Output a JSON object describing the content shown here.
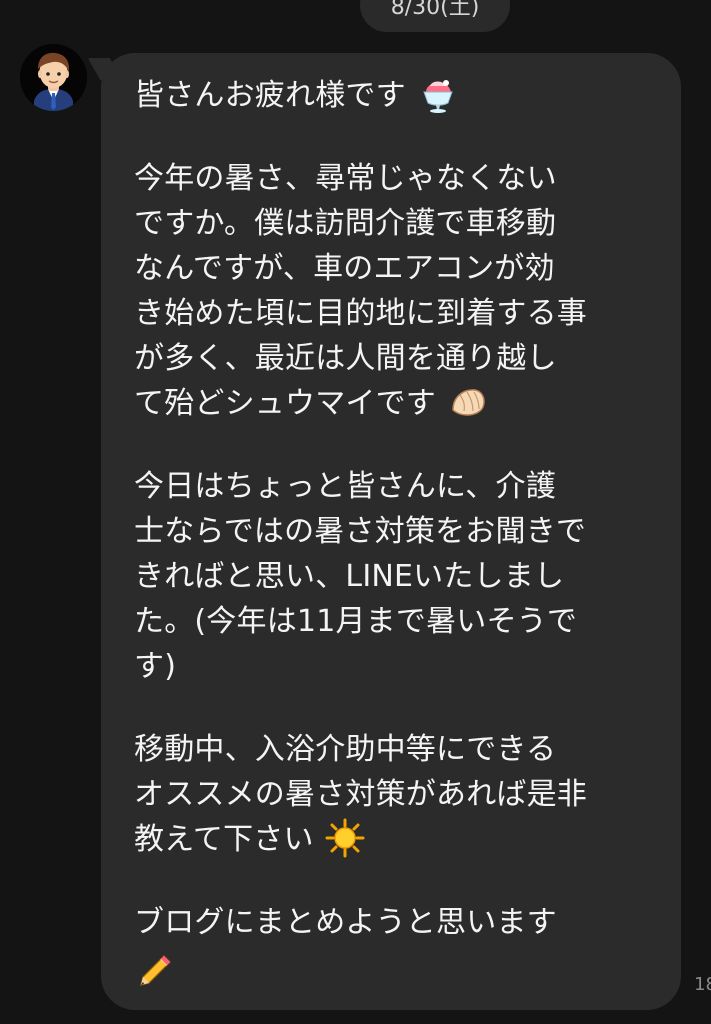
{
  "chat": {
    "date_label": "8/30(土)",
    "timestamp_fragment": "18"
  },
  "message": {
    "lines": [
      "皆さんお疲れ様です",
      "今年の暑さ、尋常じゃなくない",
      "ですか。僕は訪問介護で車移動",
      "なんですが、車のエアコンが効",
      "き始めた頃に目的地に到着する事",
      "が多く、最近は人間を通り越し",
      "て殆どシュウマイです",
      "今日はちょっと皆さんに、介護",
      "士ならではの暑さ対策をお聞きで",
      "きればと思い、LINEいたしまし",
      "た。(今年は11月まで暑いそうで",
      "す)",
      "移動中、入浴介助中等にできる",
      "オススメの暑さ対策があれば是非",
      "教えて下さい",
      "ブログにまとめようと思います"
    ],
    "emojis": {
      "line1": "shaved-ice-icon",
      "line7": "dumpling-icon",
      "line15": "sun-icon",
      "end": "pencil-icon"
    }
  },
  "colors": {
    "background": "#141414",
    "bubble": "#2b2b2b",
    "text": "#f4f4f4"
  }
}
